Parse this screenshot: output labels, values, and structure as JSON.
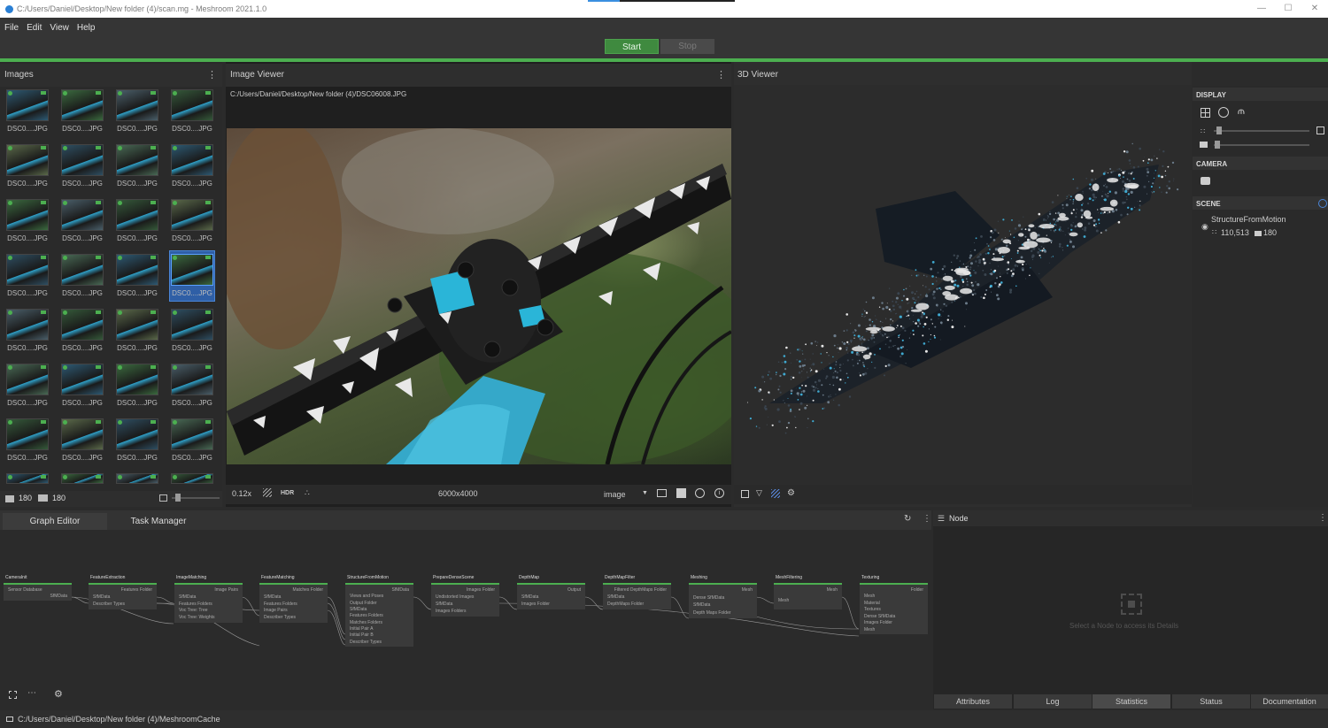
{
  "window": {
    "title": "C:/Users/Daniel/Desktop/New folder (4)/scan.mg - Meshroom 2021.1.0"
  },
  "menu": [
    "File",
    "Edit",
    "View",
    "Help"
  ],
  "toolbar": {
    "start_label": "Start",
    "stop_label": "Stop"
  },
  "images_panel": {
    "title": "Images",
    "thumb_label": "DSC0....JPG",
    "image_count": "180",
    "camera_count": "180"
  },
  "image_viewer": {
    "title": "Image Viewer",
    "path": "C:/Users/Daniel/Desktop/New folder (4)/DSC06008.JPG",
    "zoom": "0.12x",
    "hdr_label": "HDR",
    "resolution": "6000x4000",
    "mode": "image"
  },
  "viewer3d": {
    "title": "3D Viewer"
  },
  "side_panel": {
    "display_title": "DISPLAY",
    "camera_title": "CAMERA",
    "scene_title": "SCENE",
    "scene_item": "StructureFromMotion",
    "points_count": "110,513",
    "cameras_count": "180"
  },
  "graph": {
    "tab_graph": "Graph Editor",
    "tab_task": "Task Manager",
    "node_panel_title": "Node",
    "node_placeholder": "Select a Node to access its Details",
    "nodes": [
      {
        "name": "CameraInit",
        "ports": [
          "Sensor Database",
          "SfMData"
        ]
      },
      {
        "name": "FeatureExtraction",
        "ports": [
          "Features Folder",
          "SfMData",
          "Describer Types"
        ]
      },
      {
        "name": "ImageMatching",
        "ports": [
          "Image Pairs",
          "SfMData",
          "Features Folders",
          "Voc Tree: Tree",
          "Voc Tree: Weights"
        ]
      },
      {
        "name": "FeatureMatching",
        "ports": [
          "Matches Folder",
          "SfMData",
          "Features Folders",
          "Image Pairs",
          "Describer Types"
        ]
      },
      {
        "name": "StructureFromMotion",
        "ports": [
          "SfMData",
          "Views and Poses",
          "Output Folder",
          "SfMData",
          "Features Folders",
          "Matches Folders",
          "Initial Pair A",
          "Initial Pair B",
          "Describer Types"
        ]
      },
      {
        "name": "PrepareDenseScene",
        "ports": [
          "Images Folder",
          "Undistorted Images",
          "SfMData",
          "Images Folders"
        ]
      },
      {
        "name": "DepthMap",
        "ports": [
          "Output",
          "SfMData",
          "Images Folder"
        ]
      },
      {
        "name": "DepthMapFilter",
        "ports": [
          "Filtered DepthMaps Folder",
          "SfMData",
          "DepthMaps Folder"
        ]
      },
      {
        "name": "Meshing",
        "ports": [
          "Mesh",
          "Dense SfMData",
          "SfMData",
          "Depth Maps Folder"
        ]
      },
      {
        "name": "MeshFiltering",
        "ports": [
          "Mesh",
          "Mesh"
        ]
      },
      {
        "name": "Texturing",
        "ports": [
          "Folder",
          "Mesh",
          "Material",
          "Textures",
          "Dense SfMData",
          "Images Folder",
          "Mesh"
        ]
      }
    ]
  },
  "node_tabs": [
    "Attributes",
    "Log",
    "Statistics",
    "Status",
    "Documentation"
  ],
  "status": {
    "path": "C:/Users/Daniel/Desktop/New folder (4)/MeshroomCache"
  }
}
